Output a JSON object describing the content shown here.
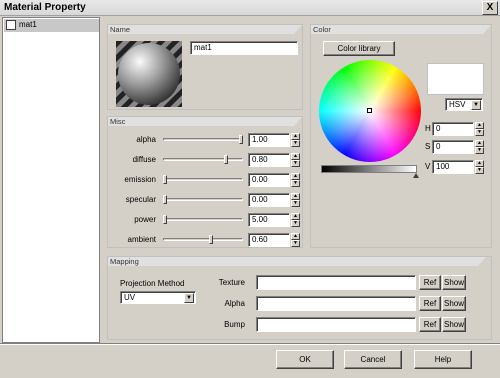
{
  "window": {
    "title": "Material Property",
    "close_glyph": "X"
  },
  "tree": {
    "items": [
      {
        "label": "mat1",
        "checked": false
      }
    ]
  },
  "name_panel": {
    "header": "Name",
    "value": "mat1"
  },
  "misc_panel": {
    "header": "Misc",
    "rows": [
      {
        "label": "alpha",
        "value": "1.00",
        "level": 1.0
      },
      {
        "label": "diffuse",
        "value": "0.80",
        "level": 0.8
      },
      {
        "label": "emission",
        "value": "0.00",
        "level": 0.0
      },
      {
        "label": "specular",
        "value": "0.00",
        "level": 0.0
      },
      {
        "label": "power",
        "value": "5.00",
        "level": 0.0
      },
      {
        "label": "ambient",
        "value": "0.60",
        "level": 0.6
      }
    ]
  },
  "color_panel": {
    "header": "Color",
    "library_button": "Color library",
    "mode": "HSV",
    "h_label": "H",
    "h_value": "0",
    "s_label": "S",
    "s_value": "0",
    "v_label": "V",
    "v_value": "100",
    "swatch_color": "#ffffff"
  },
  "mapping_panel": {
    "header": "Mapping",
    "projection_label": "Projection Method",
    "projection_value": "UV",
    "rows": [
      {
        "label": "Texture",
        "value": "",
        "ref": "Ref",
        "show": "Show"
      },
      {
        "label": "Alpha",
        "value": "",
        "ref": "Ref",
        "show": "Show"
      },
      {
        "label": "Bump",
        "value": "",
        "ref": "Ref",
        "show": "Show"
      }
    ]
  },
  "footer": {
    "ok": "OK",
    "cancel": "Cancel",
    "help": "Help"
  }
}
